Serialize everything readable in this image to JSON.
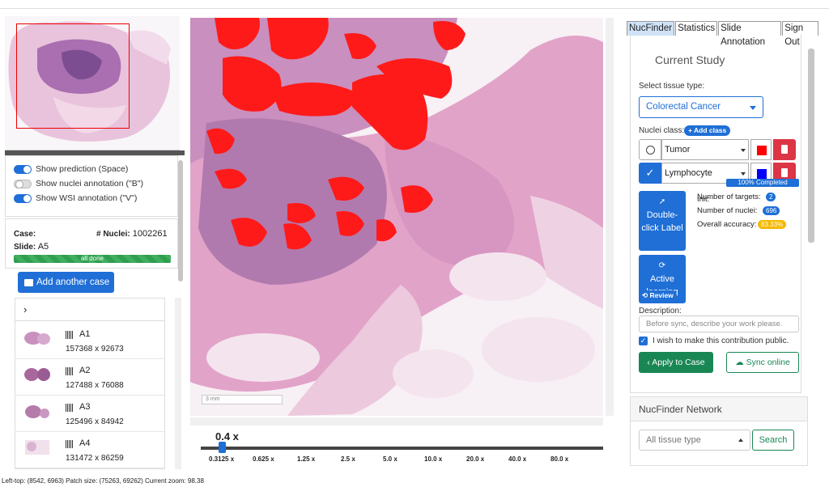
{
  "left": {
    "toggles": [
      {
        "label": "Show prediction (Space)",
        "on": true
      },
      {
        "label": "Show nuclei annotation (\"B\")",
        "on": false
      },
      {
        "label": "Show WSI annotation (\"V\")",
        "on": true
      }
    ],
    "case_label": "Case:",
    "nuclei_label": "# Nuclei:",
    "nuclei_value": "1002261",
    "slide_label": "Slide:",
    "slide_value": "A5",
    "progress_text": "all done",
    "add_case_label": "Add another case",
    "list_toggle": "›",
    "cases": [
      {
        "name": "A1",
        "dims": "157368 x 92673"
      },
      {
        "name": "A2",
        "dims": "127488 x 76088"
      },
      {
        "name": "A3",
        "dims": "125496 x 84942"
      },
      {
        "name": "A4",
        "dims": "131472 x 86259"
      }
    ]
  },
  "viewer": {
    "scalebar_text": "3 mm",
    "zoom_current": "0.4 x",
    "zoom_ticks": [
      "0.3125 x",
      "0.625 x",
      "1.25 x",
      "2.5 x",
      "5.0 x",
      "10.0 x",
      "20.0 x",
      "40.0 x",
      "80.0 x"
    ],
    "status": "Left-top: (8542, 6963) Patch size: (75263, 69262) Current zoom: 98.38",
    "overlay_color": "#ff0000"
  },
  "right": {
    "tabs": [
      "NucFinder",
      "Statistics",
      "Slide Annotation",
      "Sign Out"
    ],
    "active_tab": "NucFinder",
    "study_title": "Current Study",
    "tissue_label": "Select tissue type:",
    "tissue_value": "Colorectal Cancer",
    "nuclei_class_label": "Nuclei class:",
    "add_class_label": "+ Add class",
    "classes": [
      {
        "name": "Tumor",
        "color": "#ff0000",
        "checked": false
      },
      {
        "name": "Lymphocyte",
        "color": "#0000ff",
        "checked": true
      }
    ],
    "double_click_label": "Double-click Label",
    "active_learning_label": "Active learning",
    "review_label": "Review",
    "init_label": "Init:",
    "init_progress": "100% Completed",
    "targets_label": "Number of targets:",
    "targets_value": "2",
    "nuclei_label": "Number of nuclei:",
    "nuclei_value": "696",
    "accuracy_label": "Overall accuracy:",
    "accuracy_value": "83.33%",
    "description_label": "Description:",
    "description_placeholder": "Before sync, describe your work please.",
    "public_label": "I wish to make this contribution public.",
    "apply_label": "Apply to Case",
    "sync_label": "Sync online",
    "network_title": "NucFinder Network",
    "network_select": "All tissue type",
    "search_label": "Search"
  }
}
